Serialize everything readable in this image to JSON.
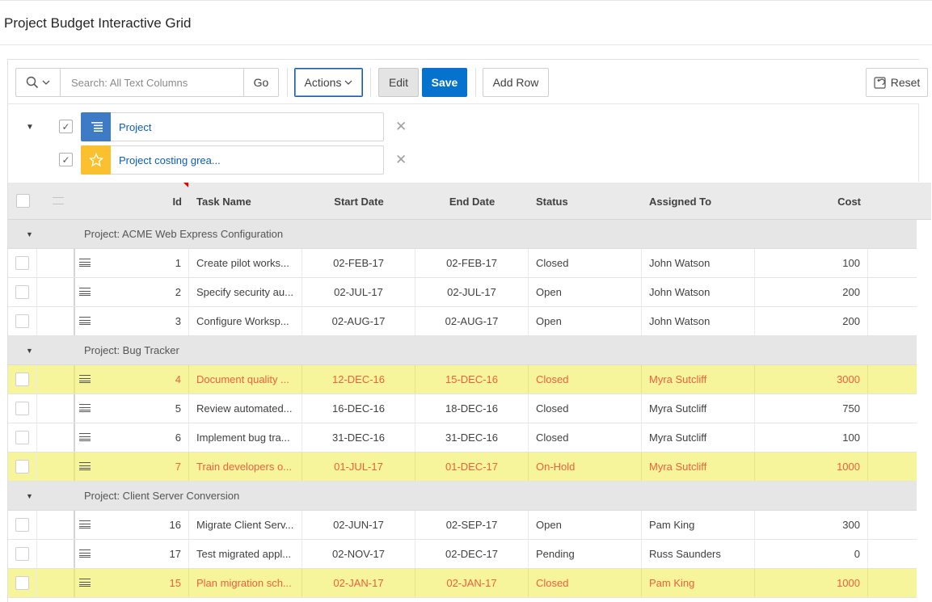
{
  "page": {
    "title": "Project Budget Interactive Grid"
  },
  "toolbar": {
    "search_placeholder": "Search: All Text Columns",
    "go_label": "Go",
    "actions_label": "Actions",
    "edit_label": "Edit",
    "save_label": "Save",
    "add_row_label": "Add Row",
    "reset_label": "Reset"
  },
  "filters": [
    {
      "label": "Project",
      "icon": "control-break-icon",
      "color": "#3d7bc6",
      "checked": true
    },
    {
      "label": "Project costing grea...",
      "icon": "star-icon",
      "color": "#fbc02d",
      "checked": true
    }
  ],
  "columns": {
    "id": "Id",
    "task": "Task Name",
    "start": "Start Date",
    "end": "End Date",
    "status": "Status",
    "assigned": "Assigned To",
    "cost": "Cost"
  },
  "groups": [
    {
      "label": "Project: ACME Web Express Configuration",
      "rows": [
        {
          "id": "1",
          "task": "Create pilot works...",
          "start": "02-FEB-17",
          "end": "02-FEB-17",
          "status": "Closed",
          "assigned": "John Watson",
          "cost": "100",
          "highlight": false
        },
        {
          "id": "2",
          "task": "Specify security au...",
          "start": "02-JUL-17",
          "end": "02-JUL-17",
          "status": "Open",
          "assigned": "John Watson",
          "cost": "200",
          "highlight": false
        },
        {
          "id": "3",
          "task": "Configure Worksp...",
          "start": "02-AUG-17",
          "end": "02-AUG-17",
          "status": "Open",
          "assigned": "John Watson",
          "cost": "200",
          "highlight": false
        }
      ]
    },
    {
      "label": "Project: Bug Tracker",
      "rows": [
        {
          "id": "4",
          "task": "Document quality ...",
          "start": "12-DEC-16",
          "end": "15-DEC-16",
          "status": "Closed",
          "assigned": "Myra Sutcliff",
          "cost": "3000",
          "highlight": true
        },
        {
          "id": "5",
          "task": "Review automated...",
          "start": "16-DEC-16",
          "end": "18-DEC-16",
          "status": "Closed",
          "assigned": "Myra Sutcliff",
          "cost": "750",
          "highlight": false
        },
        {
          "id": "6",
          "task": "Implement bug tra...",
          "start": "31-DEC-16",
          "end": "31-DEC-16",
          "status": "Closed",
          "assigned": "Myra Sutcliff",
          "cost": "100",
          "highlight": false
        },
        {
          "id": "7",
          "task": "Train developers o...",
          "start": "01-JUL-17",
          "end": "01-DEC-17",
          "status": "On-Hold",
          "assigned": "Myra Sutcliff",
          "cost": "1000",
          "highlight": true
        }
      ]
    },
    {
      "label": "Project: Client Server Conversion",
      "rows": [
        {
          "id": "16",
          "task": "Migrate Client Serv...",
          "start": "02-JUN-17",
          "end": "02-SEP-17",
          "status": "Open",
          "assigned": "Pam King",
          "cost": "300",
          "highlight": false
        },
        {
          "id": "17",
          "task": "Test migrated appl...",
          "start": "02-NOV-17",
          "end": "02-DEC-17",
          "status": "Pending",
          "assigned": "Russ Saunders",
          "cost": "0",
          "highlight": false
        },
        {
          "id": "15",
          "task": "Plan migration sch...",
          "start": "02-JAN-17",
          "end": "02-JAN-17",
          "status": "Closed",
          "assigned": "Pam King",
          "cost": "1000",
          "highlight": true
        }
      ]
    }
  ]
}
